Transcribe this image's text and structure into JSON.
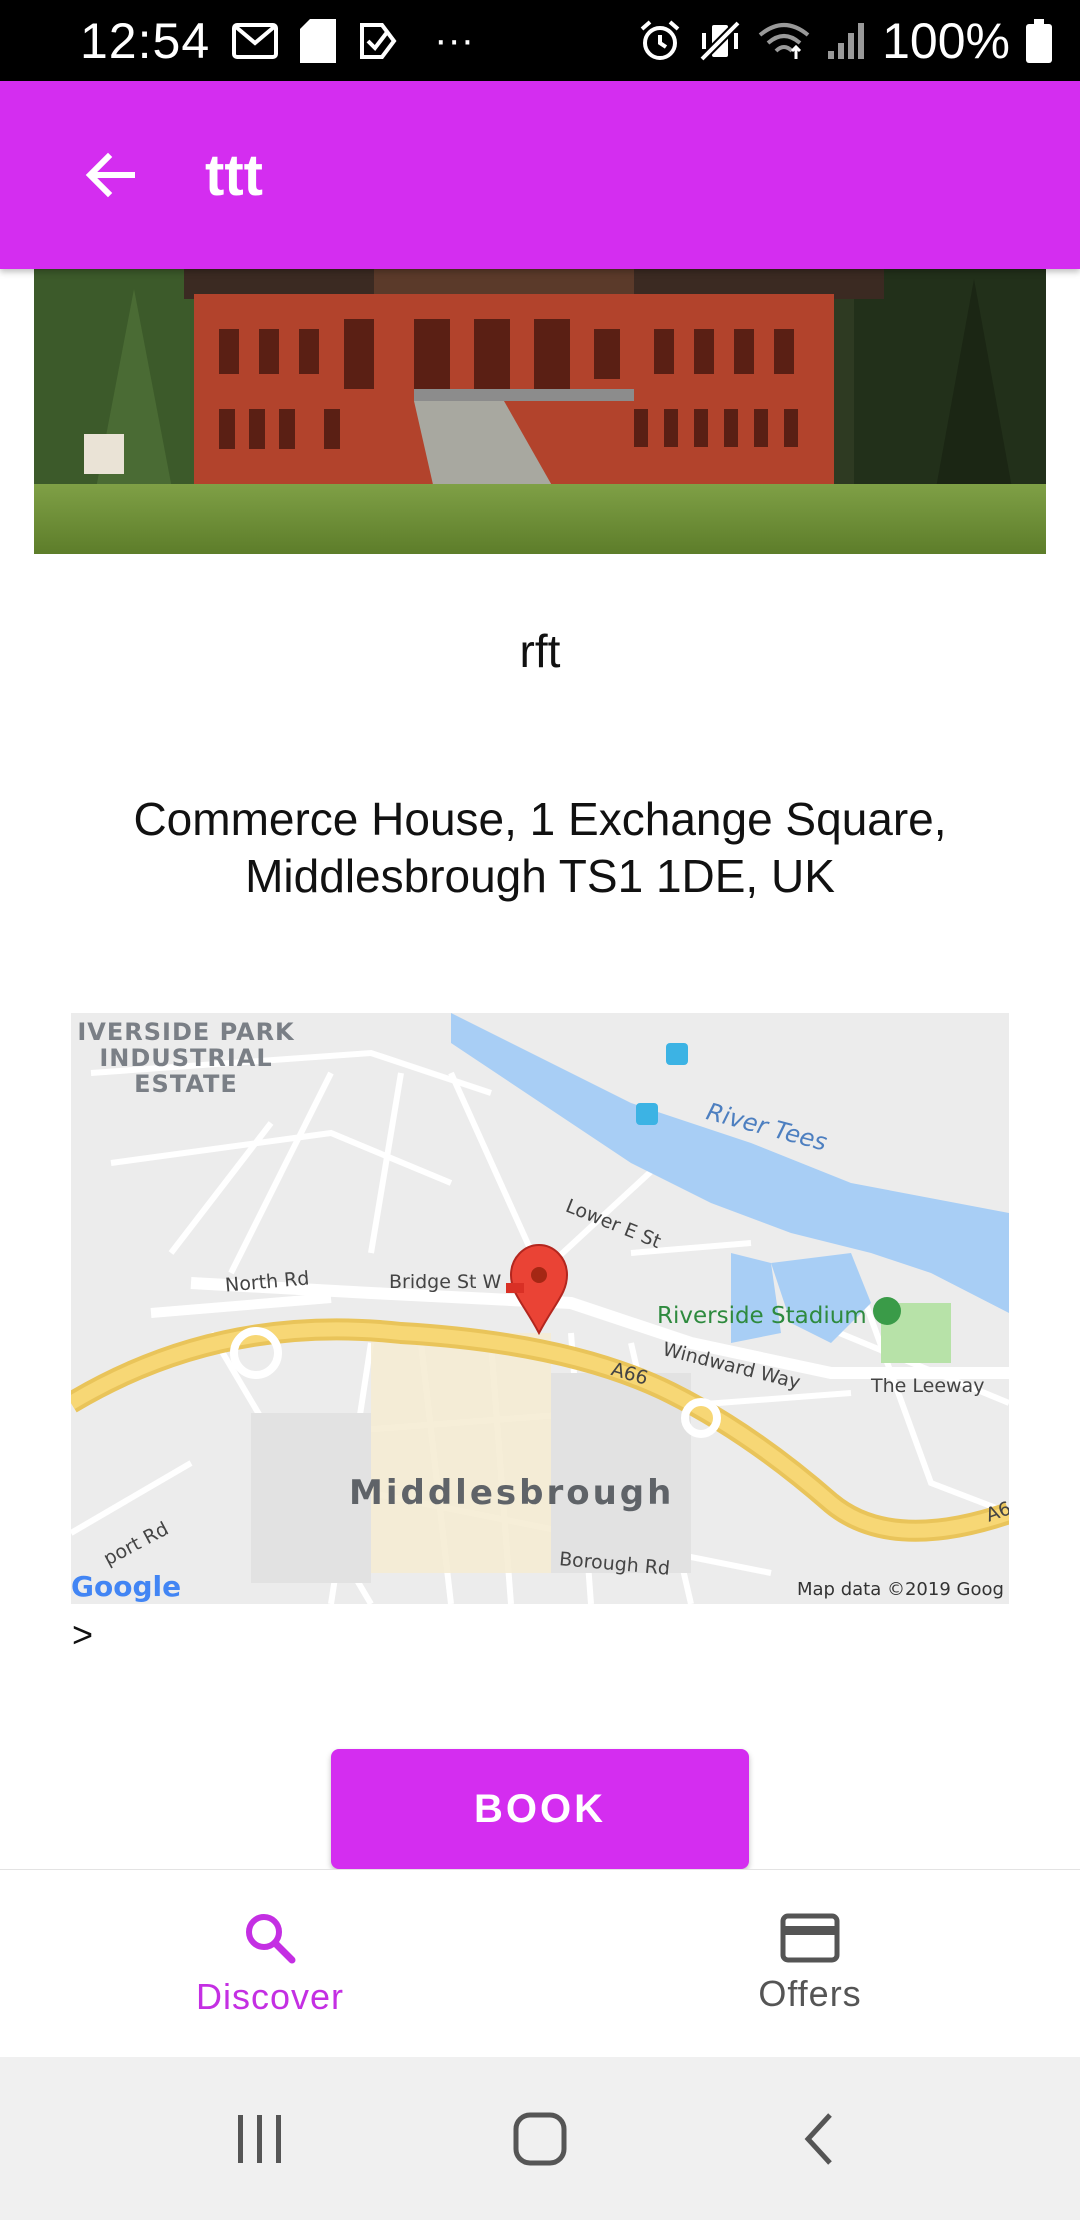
{
  "status_bar": {
    "time": "12:54",
    "battery": "100%",
    "more": "···"
  },
  "app_bar": {
    "title": "ttt"
  },
  "place": {
    "name": "rft",
    "address": "Commerce House, 1 Exchange Square, Middlesbrough TS1 1DE, UK"
  },
  "map": {
    "labels": {
      "industrial_estate": "IVERSIDE PARK INDUSTRIAL ESTATE",
      "river": "River Tees",
      "lower_e_st": "Lower E St",
      "north_rd": "North Rd",
      "bridge_st": "Bridge St W",
      "stadium": "Riverside Stadium",
      "windward_way": "Windward Way",
      "leeway": "The Leeway",
      "a66": "A66",
      "a66_short": "A6",
      "city": "Middlesbrough",
      "borough_rd": "Borough Rd",
      "port_rd": "port Rd",
      "google": "Google",
      "map_data": "Map data ©2019 Goog"
    },
    "colors": {
      "water": "#a8cef5",
      "road_major": "#f7d775",
      "park": "#b7e2a8",
      "pin": "#ea4335"
    }
  },
  "link_text": ">",
  "book_button": {
    "label": "BOOK"
  },
  "bottom_nav": {
    "items": [
      {
        "label": "Discover",
        "icon": "search-icon",
        "active": true
      },
      {
        "label": "Offers",
        "icon": "credit-card-icon",
        "active": false
      }
    ]
  },
  "colors": {
    "accent": "#d42df0",
    "accent_text": "#c42fe3"
  }
}
